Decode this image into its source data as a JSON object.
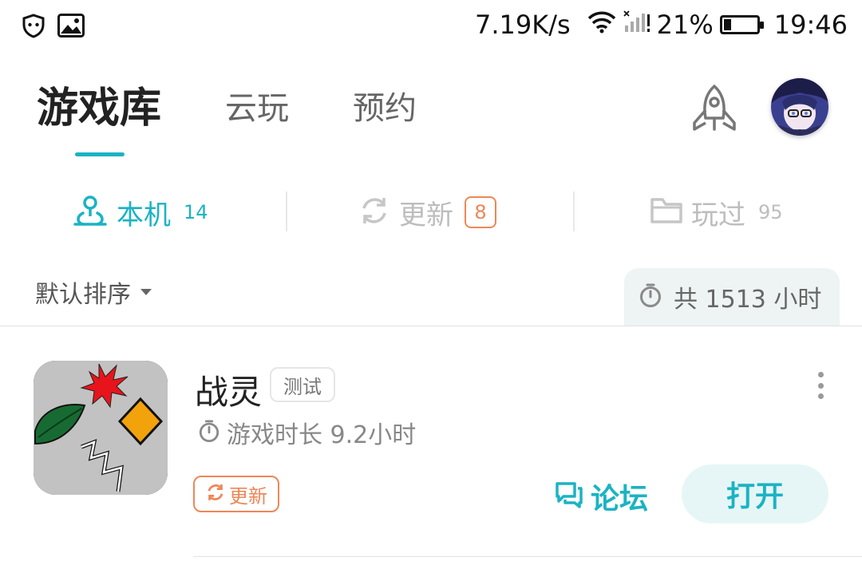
{
  "status_bar": {
    "speed": "7.19K/s",
    "battery_pct": "21%",
    "battery_level": 0.21,
    "time": "19:46"
  },
  "top_tabs": [
    {
      "label": "游戏库",
      "active": true
    },
    {
      "label": "云玩",
      "active": false
    },
    {
      "label": "预约",
      "active": false
    }
  ],
  "sub_tabs": [
    {
      "label": "本机",
      "count": "14",
      "icon": "local-device-icon",
      "active": true
    },
    {
      "label": "更新",
      "count": "8",
      "icon": "refresh-icon",
      "active": false
    },
    {
      "label": "玩过",
      "count": "95",
      "icon": "folder-icon",
      "active": false
    }
  ],
  "sort": {
    "label": "默认排序"
  },
  "total_time": {
    "label": "共 1513 小时"
  },
  "games": [
    {
      "name": "战灵",
      "tag": "测试",
      "playtime": "游戏时长 9.2小时",
      "update_label": "更新",
      "forum_label": "论坛",
      "open_label": "打开"
    }
  ],
  "colors": {
    "accent": "#1bb3c4",
    "update": "#ee8757",
    "open_bg": "#e6f6f6"
  }
}
